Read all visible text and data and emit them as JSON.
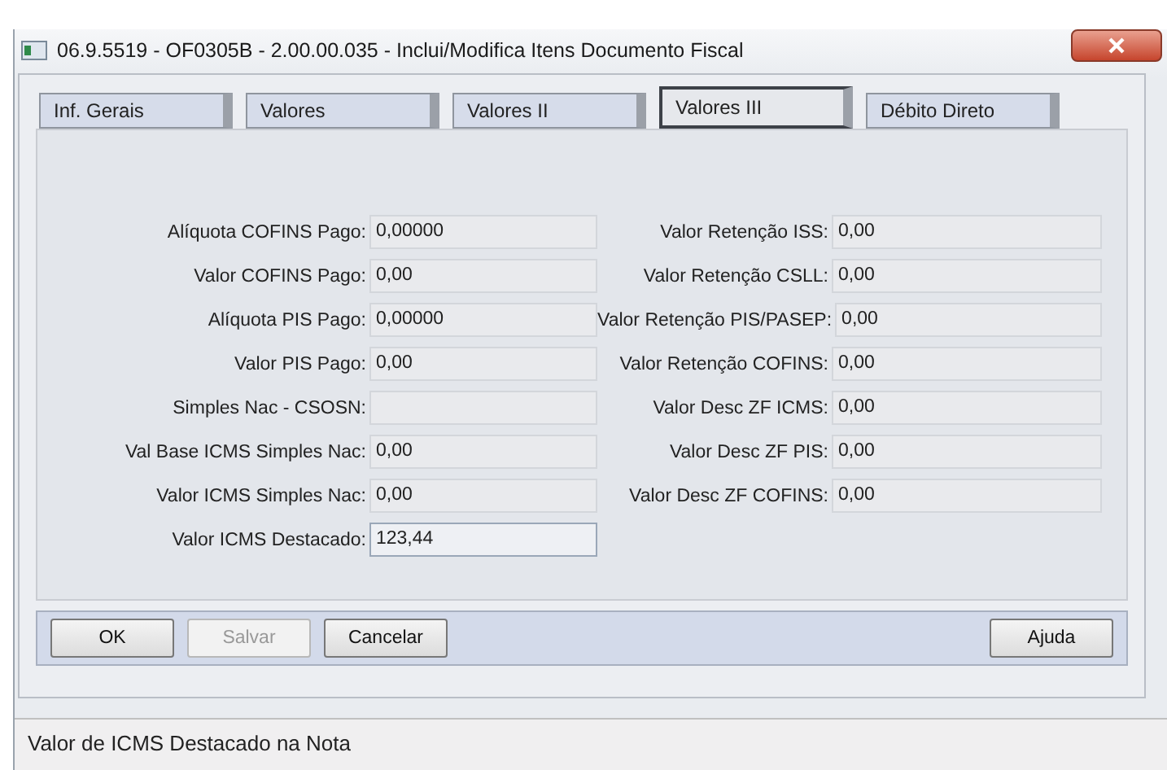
{
  "window": {
    "title": "06.9.5519 - OF0305B - 2.00.00.035 - Inclui/Modifica Itens Documento Fiscal"
  },
  "tabs": [
    {
      "label": "Inf. Gerais",
      "selected": false
    },
    {
      "label": "Valores",
      "selected": false
    },
    {
      "label": "Valores II",
      "selected": false
    },
    {
      "label": "Valores III",
      "selected": true
    },
    {
      "label": "Débito Direto",
      "selected": false
    }
  ],
  "left_fields": [
    {
      "label": "Alíquota COFINS Pago:",
      "value": "0,00000"
    },
    {
      "label": "Valor COFINS Pago:",
      "value": "0,00"
    },
    {
      "label": "Alíquota PIS Pago:",
      "value": "0,00000"
    },
    {
      "label": "Valor PIS Pago:",
      "value": "0,00"
    },
    {
      "label": "Simples Nac - CSOSN:"
    },
    {
      "label": "Val Base ICMS Simples Nac:",
      "value": "0,00"
    },
    {
      "label": "Valor ICMS Simples Nac:",
      "value": "0,00"
    },
    {
      "label": "Valor ICMS Destacado:",
      "value": "123,44",
      "disabled": false
    }
  ],
  "right_fields": [
    {
      "label": "Valor Retenção ISS:",
      "value": "0,00"
    },
    {
      "label": "Valor Retenção CSLL:",
      "value": "0,00"
    },
    {
      "label": "Valor Retenção PIS/PASEP:",
      "value": "0,00"
    },
    {
      "label": "Valor Retenção COFINS:",
      "value": "0,00"
    },
    {
      "label": "Valor Desc ZF ICMS:",
      "value": "0,00"
    },
    {
      "label": "Valor Desc ZF PIS:",
      "value": "0,00"
    },
    {
      "label": "Valor Desc ZF COFINS:",
      "value": "0,00"
    }
  ],
  "buttons": [
    {
      "label": "OK",
      "disabled": false
    },
    {
      "label": "Salvar",
      "disabled": true
    },
    {
      "label": "Cancelar",
      "disabled": false
    }
  ],
  "help_button": {
    "label": "Ajuda"
  },
  "status_bar": "Valor de ICMS Destacado na Nota"
}
